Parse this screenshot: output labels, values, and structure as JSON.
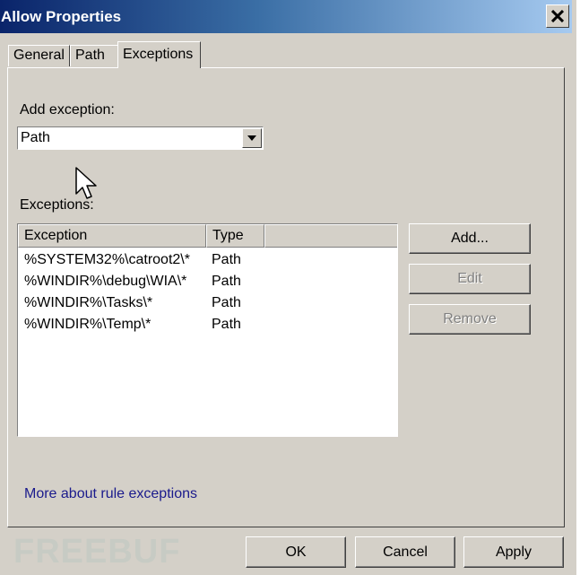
{
  "window": {
    "title": "Allow Properties"
  },
  "tabs": [
    {
      "label": "General"
    },
    {
      "label": "Path"
    },
    {
      "label": "Exceptions"
    }
  ],
  "add_exception": {
    "label": "Add exception:",
    "selected": "Path"
  },
  "exceptions": {
    "label": "Exceptions:",
    "columns": [
      "Exception",
      "Type"
    ],
    "rows": [
      {
        "exception": "%SYSTEM32%\\catroot2\\*",
        "type": "Path"
      },
      {
        "exception": "%WINDIR%\\debug\\WIA\\*",
        "type": "Path"
      },
      {
        "exception": "%WINDIR%\\Tasks\\*",
        "type": "Path"
      },
      {
        "exception": "%WINDIR%\\Temp\\*",
        "type": "Path"
      }
    ]
  },
  "side_buttons": {
    "add": "Add...",
    "edit": "Edit",
    "remove": "Remove"
  },
  "link": "More about rule exceptions",
  "footer": {
    "ok": "OK",
    "cancel": "Cancel",
    "apply": "Apply"
  },
  "watermark": "FREEBUF",
  "icons": {
    "close": "close-icon",
    "dropdown": "chevron-down-icon",
    "cursor": "mouse-pointer-icon"
  }
}
